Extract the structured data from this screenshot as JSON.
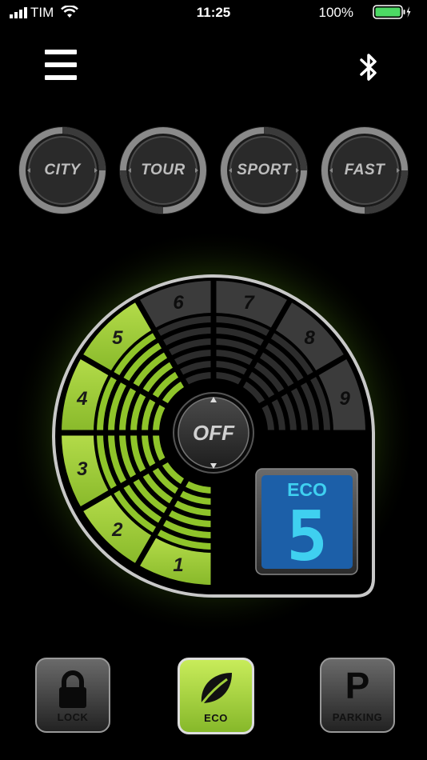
{
  "status_bar": {
    "carrier": "TIM",
    "time": "11:25",
    "battery": "100%",
    "icons": [
      "signal-icon",
      "wifi-icon",
      "battery-icon",
      "charging-icon"
    ]
  },
  "header": {
    "menu_icon": "hamburger-menu-icon",
    "bluetooth_icon": "bluetooth-icon"
  },
  "modes": [
    {
      "label": "CITY"
    },
    {
      "label": "TOUR"
    },
    {
      "label": "SPORT"
    },
    {
      "label": "FAST"
    }
  ],
  "dial": {
    "levels": [
      "1",
      "2",
      "3",
      "4",
      "5",
      "6",
      "7",
      "8",
      "9"
    ],
    "active_levels": 5,
    "off_label": "OFF",
    "display": {
      "mode": "ECO",
      "value": "5"
    }
  },
  "bottom_buttons": [
    {
      "label": "LOCK",
      "icon": "lock-icon"
    },
    {
      "label": "ECO",
      "icon": "leaf-icon",
      "active": true
    },
    {
      "label": "PARKING",
      "icon": "P",
      "letter": "P"
    }
  ],
  "colors": {
    "accent_green": "#a8d93a",
    "display_blue": "#1c5fa8",
    "display_digit": "#3fd0f0"
  }
}
